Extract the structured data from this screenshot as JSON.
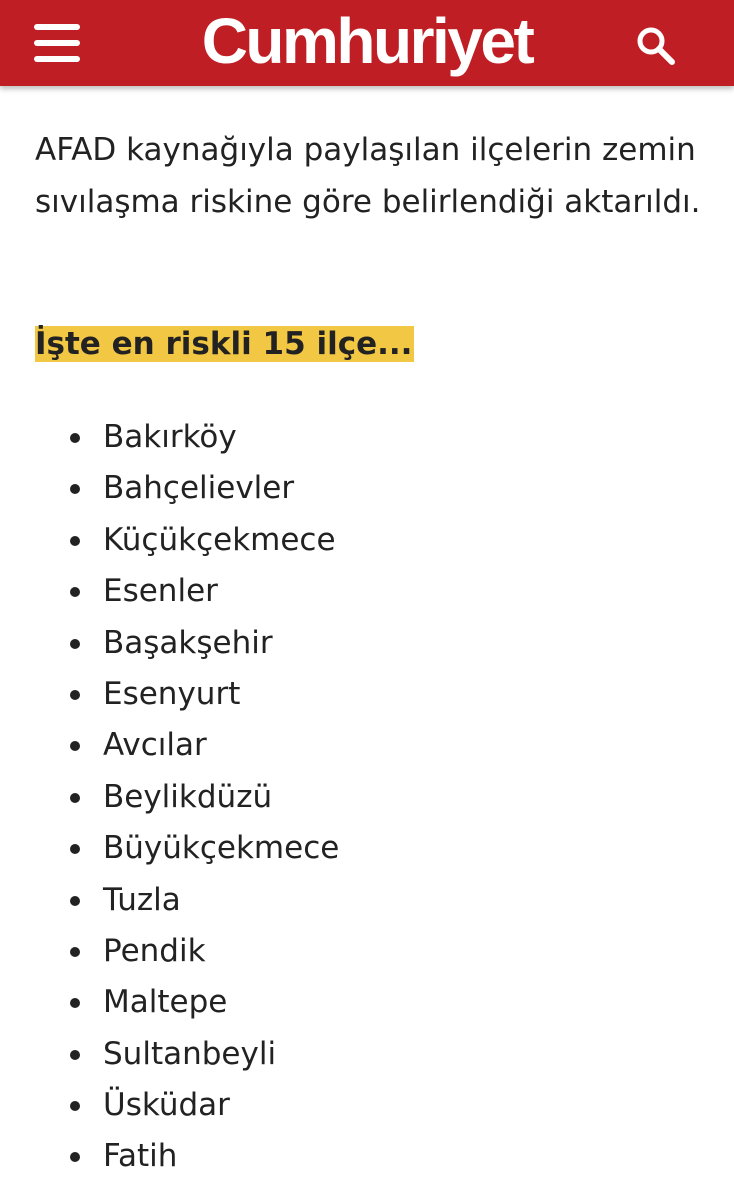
{
  "header": {
    "logo_text": "Cumhuriyet",
    "menu_icon": "hamburger-menu-icon",
    "search_icon": "search-icon",
    "background_color": "#bf1f24"
  },
  "article": {
    "intro_text": "AFAD kaynağıyla paylaşılan ilçelerin zemin sıvılaşma riskine göre belirlendiği aktarıldı.",
    "highlight_text": "İşte en riskli 15 ilçe...",
    "highlight_color": "#f2c744",
    "districts": [
      "Bakırköy",
      "Bahçelievler",
      "Küçükçekmece",
      "Esenler",
      "Başakşehir",
      "Esenyurt",
      "Avcılar",
      "Beylikdüzü",
      "Büyükçekmece",
      "Tuzla",
      "Pendik",
      "Maltepe",
      "Sultanbeyli",
      "Üsküdar",
      "Fatih"
    ]
  }
}
